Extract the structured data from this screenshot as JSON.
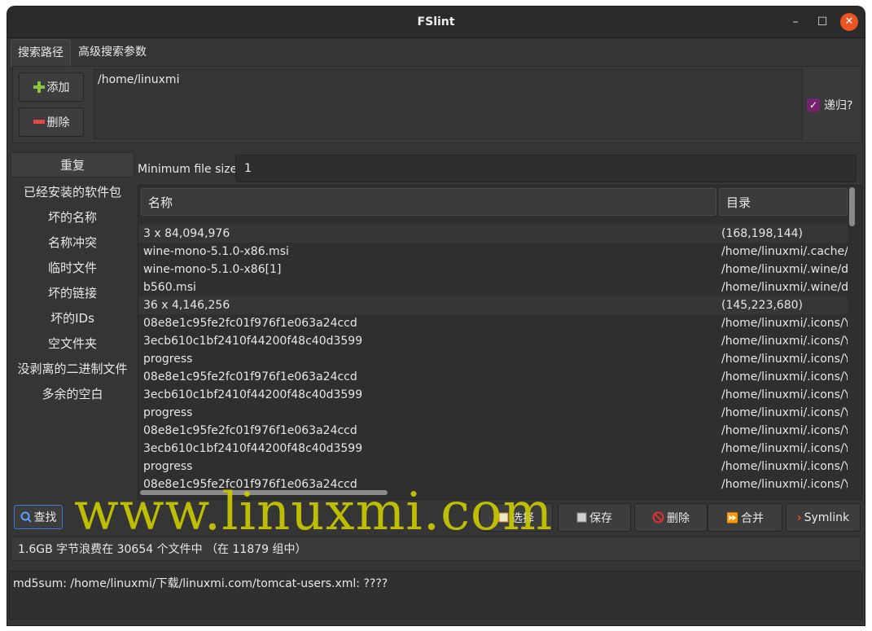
{
  "window": {
    "title": "FSlint",
    "minimize": "–",
    "maximize": "☐",
    "close": "✕"
  },
  "top_tabs": [
    "搜索路径",
    "高级搜索参数"
  ],
  "path_panel": {
    "add_label": "添加",
    "remove_label": "删除",
    "paths": [
      "/home/linuxmi"
    ],
    "recursive_label": "递归?",
    "recursive_checked": true
  },
  "sidebar": {
    "items": [
      "重复",
      "已经安装的软件包",
      "坏的名称",
      "名称冲突",
      "临时文件",
      "坏的链接",
      "坏的IDs",
      "空文件夹",
      "没剥离的二进制文件",
      "多余的空白"
    ],
    "active_index": 0
  },
  "filter": {
    "min_size_label": "Minimum file size:",
    "min_size_value": "1"
  },
  "table": {
    "columns": [
      "名称",
      "目录"
    ],
    "rows": [
      {
        "name": "3 x 84,094,976",
        "dir": "(168,198,144)",
        "group": true
      },
      {
        "name": "wine-mono-5.1.0-x86.msi",
        "dir": "/home/linuxmi/.cache/",
        "group": false
      },
      {
        "name": "wine-mono-5.1.0-x86[1]",
        "dir": "/home/linuxmi/.wine/d",
        "group": false
      },
      {
        "name": "b560.msi",
        "dir": "/home/linuxmi/.wine/d",
        "group": false
      },
      {
        "name": "36 x 4,146,256",
        "dir": "(145,223,680)",
        "group": true
      },
      {
        "name": "08e8e1c95fe2fc01f976f1e063a24ccd",
        "dir": "/home/linuxmi/.icons/Y",
        "group": false
      },
      {
        "name": "3ecb610c1bf2410f44200f48c40d3599",
        "dir": "/home/linuxmi/.icons/Y",
        "group": false
      },
      {
        "name": "progress",
        "dir": "/home/linuxmi/.icons/Y",
        "group": false
      },
      {
        "name": "08e8e1c95fe2fc01f976f1e063a24ccd",
        "dir": "/home/linuxmi/.icons/Y",
        "group": false
      },
      {
        "name": "3ecb610c1bf2410f44200f48c40d3599",
        "dir": "/home/linuxmi/.icons/Y",
        "group": false
      },
      {
        "name": "progress",
        "dir": "/home/linuxmi/.icons/Y",
        "group": false
      },
      {
        "name": "08e8e1c95fe2fc01f976f1e063a24ccd",
        "dir": "/home/linuxmi/.icons/Y",
        "group": false
      },
      {
        "name": "3ecb610c1bf2410f44200f48c40d3599",
        "dir": "/home/linuxmi/.icons/Y",
        "group": false
      },
      {
        "name": "progress",
        "dir": "/home/linuxmi/.icons/Y",
        "group": false
      },
      {
        "name": "08e8e1c95fe2fc01f976f1e063a24ccd",
        "dir": "/home/linuxmi/.icons/Y",
        "group": false
      }
    ]
  },
  "actions": {
    "find": "查找",
    "select": "选择",
    "save": "保存",
    "delete": "删除",
    "merge": "合并",
    "symlink": "Symlink"
  },
  "status": "1.6GB 字节浪费在 30654 个文件中 （在 11879 组中）",
  "log": "md5sum: /home/linuxmi/下载/linuxmi.com/tomcat-users.xml: ????",
  "watermark": "www.linuxmi.com",
  "colors": {
    "accent": "#e95420",
    "checkbox": "#77216f",
    "watermark": "#c8c800"
  }
}
